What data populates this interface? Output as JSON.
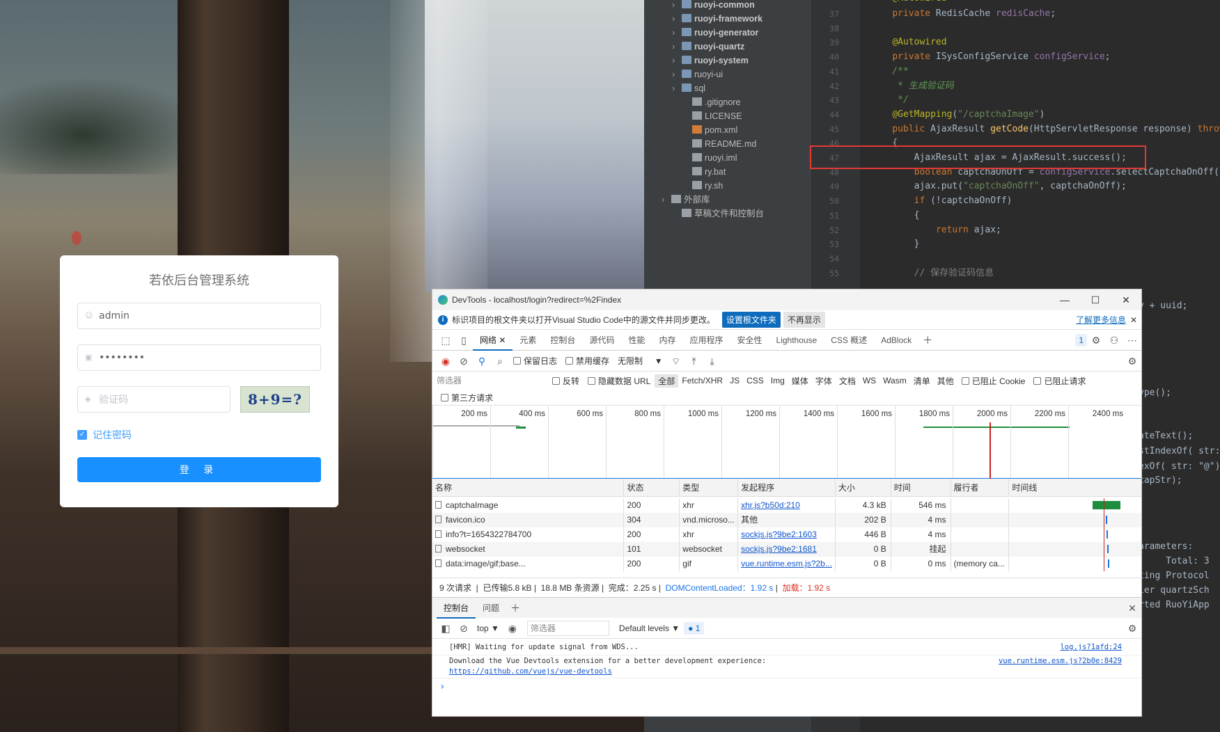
{
  "login": {
    "title": "若依后台管理系统",
    "username": "admin",
    "password": "••••••••",
    "captcha_placeholder": "验证码",
    "captcha_image_text": "8+9=?",
    "remember_label": "记住密码",
    "login_button": "登 录"
  },
  "ide": {
    "tree": [
      {
        "label": "ruoyi-common",
        "kind": "module",
        "arrow": "›"
      },
      {
        "label": "ruoyi-framework",
        "kind": "module",
        "arrow": "›"
      },
      {
        "label": "ruoyi-generator",
        "kind": "module",
        "arrow": "›"
      },
      {
        "label": "ruoyi-quartz",
        "kind": "module",
        "arrow": "›"
      },
      {
        "label": "ruoyi-system",
        "kind": "module",
        "arrow": "›"
      },
      {
        "label": "ruoyi-ui",
        "kind": "folder",
        "arrow": "›"
      },
      {
        "label": "sql",
        "kind": "folder",
        "arrow": "›"
      },
      {
        "label": ".gitignore",
        "kind": "file",
        "arrow": ""
      },
      {
        "label": "LICENSE",
        "kind": "file",
        "arrow": ""
      },
      {
        "label": "pom.xml",
        "kind": "xml",
        "arrow": ""
      },
      {
        "label": "README.md",
        "kind": "file",
        "arrow": ""
      },
      {
        "label": "ruoyi.iml",
        "kind": "file",
        "arrow": ""
      },
      {
        "label": "ry.bat",
        "kind": "file",
        "arrow": ""
      },
      {
        "label": "ry.sh",
        "kind": "file",
        "arrow": ""
      },
      {
        "label": "外部库",
        "kind": "lib",
        "arrow": "›"
      },
      {
        "label": "草稿文件和控制台",
        "kind": "scratch",
        "arrow": ""
      }
    ],
    "line_numbers": [
      "37",
      "38",
      "39",
      "40",
      "41",
      "42",
      "43",
      "44",
      "45",
      "46",
      "47",
      "48",
      "49",
      "50",
      "51",
      "52",
      "53",
      "54",
      "55"
    ],
    "code_lines": [
      "    private RedisCache redisCache;",
      "",
      "    @Autowired",
      "    private ISysConfigService configService;",
      "    /**",
      "     * 生成验证码",
      "     */",
      "    @GetMapping(\"/captchaImage\")",
      "    public AjaxResult getCode(HttpServletResponse response) throws",
      "    {",
      "        AjaxResult ajax = AjaxResult.success();",
      "        boolean captchaOnOff = configService.selectCaptchaOnOff()",
      "        ajax.put(\"captchaOnOff\", captchaOnOff);",
      "        if (!captchaOnOff)",
      "        {",
      "            return ajax;",
      "        }",
      "",
      "        // 保存验证码信息"
    ],
    "top_partial_line": "    @Autowired",
    "right_fragments": [
      "y + uuid;",
      "ype();",
      "ateText();",
      "stIndexOf( str:",
      "exOf( str: \"@\")",
      "capStr);",
      "arameters:",
      "     Total: 3",
      "ting Protocol",
      "ler quartzSch",
      "rted RuoYiApp"
    ]
  },
  "devtools": {
    "title": "DevTools - localhost/login?redirect=%2Findex",
    "window_controls": [
      "—",
      "☐",
      "✕"
    ],
    "info_text": "标识项目的根文件夹以打开Visual Studio Code中的源文件并同步更改。",
    "info_primary_button": "设置根文件夹",
    "info_secondary_button": "不再显示",
    "info_link": "了解更多信息",
    "tabs": [
      "网络",
      "元素",
      "控制台",
      "源代码",
      "性能",
      "内存",
      "应用程序",
      "安全性",
      "Lighthouse",
      "CSS 概述",
      "AdBlock"
    ],
    "issues_badge": "1",
    "net_toolbar": {
      "preserve_log": "保留日志",
      "disable_cache": "禁用缓存",
      "throttle": "无限制"
    },
    "filter": {
      "placeholder": "筛选器",
      "invert": "反转",
      "hide_data_urls": "隐藏数据 URL",
      "types": [
        "全部",
        "Fetch/XHR",
        "JS",
        "CSS",
        "Img",
        "媒体",
        "字体",
        "文档",
        "WS",
        "Wasm",
        "清单",
        "其他"
      ],
      "blocked_cookies": "已阻止 Cookie",
      "blocked_requests": "已阻止请求",
      "third_party": "第三方请求"
    },
    "timeline_ticks": [
      "200 ms",
      "400 ms",
      "600 ms",
      "800 ms",
      "1000 ms",
      "1200 ms",
      "1400 ms",
      "1600 ms",
      "1800 ms",
      "2000 ms",
      "2200 ms",
      "2400 ms"
    ],
    "columns": [
      "名称",
      "状态",
      "类型",
      "发起程序",
      "大小",
      "时间",
      "履行者",
      "时间线"
    ],
    "rows": [
      {
        "name": "captchaImage",
        "status": "200",
        "type": "xhr",
        "initiator": "xhr.js?b50d:210",
        "size": "4.3 kB",
        "time": "546 ms",
        "fulfilled": ""
      },
      {
        "name": "favicon.ico",
        "status": "304",
        "type": "vnd.microso...",
        "initiator": "其他",
        "size": "202 B",
        "time": "4 ms",
        "fulfilled": ""
      },
      {
        "name": "info?t=1654322784700",
        "status": "200",
        "type": "xhr",
        "initiator": "sockjs.js?9be2:1603",
        "size": "446 B",
        "time": "4 ms",
        "fulfilled": ""
      },
      {
        "name": "websocket",
        "status": "101",
        "type": "websocket",
        "initiator": "sockjs.js?9be2:1681",
        "size": "0 B",
        "time": "挂起",
        "fulfilled": ""
      },
      {
        "name": "data:image/gif;base...",
        "status": "200",
        "type": "gif",
        "initiator": "vue.runtime.esm.js?2b...",
        "size": "0 B",
        "time": "0 ms",
        "fulfilled": "(memory ca..."
      }
    ],
    "summary": {
      "requests": "9 次请求",
      "transferred": "已传输5.8 kB",
      "resources": "18.8 MB 条资源",
      "finish": "完成：2.25 s",
      "dcl": "DOMContentLoaded：1.92 s",
      "load": "加载：1.92 s"
    },
    "drawer_tabs": [
      "控制台",
      "问题"
    ],
    "console_toolbar": {
      "context": "top",
      "filter_placeholder": "筛选器",
      "levels": "Default levels",
      "badge": "1"
    },
    "console_lines": [
      {
        "text": "[HMR] Waiting for update signal from WDS...",
        "source": "log.js?1afd:24"
      },
      {
        "text": "Download the Vue Devtools extension for a better development experience:",
        "source": "vue.runtime.esm.js?2b0e:8429"
      },
      {
        "text": "https://github.com/vuejs/vue-devtools",
        "source": ""
      }
    ],
    "prompt": "›"
  }
}
